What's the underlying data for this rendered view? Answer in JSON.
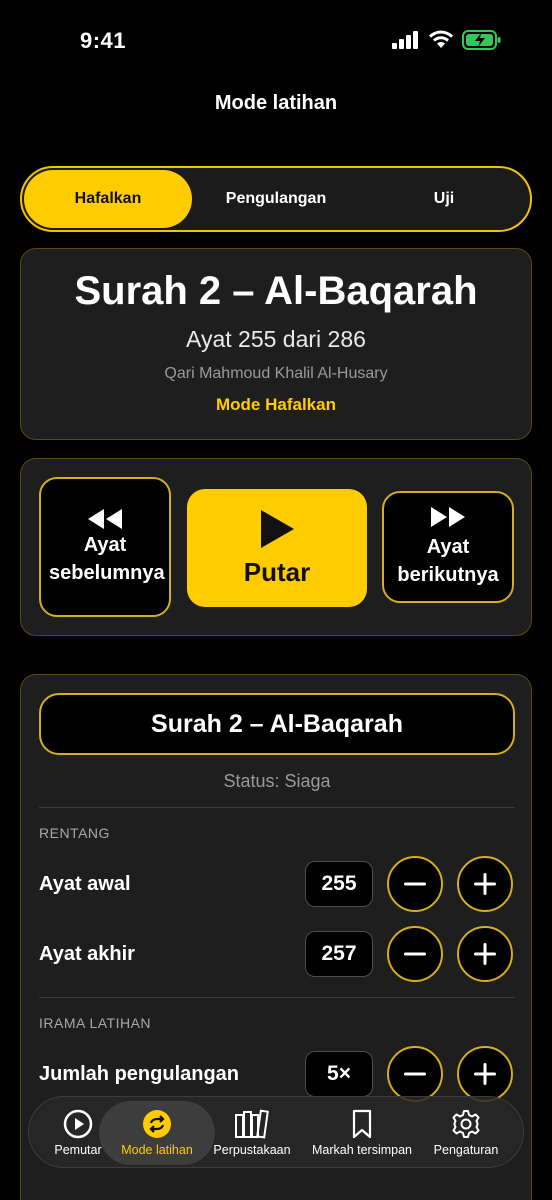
{
  "status_bar": {
    "time": "9:41"
  },
  "nav": {
    "title": "Mode latihan"
  },
  "segments": [
    {
      "label": "Hafalkan",
      "active": true
    },
    {
      "label": "Pengulangan",
      "active": false
    },
    {
      "label": "Uji",
      "active": false
    }
  ],
  "surah_card": {
    "title": "Surah 2 – Al-Baqarah",
    "ayat": "Ayat 255 dari 286",
    "qari": "Qari Mahmoud Khalil Al-Husary",
    "mode": "Mode Hafalkan"
  },
  "controls": {
    "prev_label": "Ayat sebelumnya",
    "play_label": "Putar",
    "next_label": "Ayat berikutnya"
  },
  "settings": {
    "surah_select": "Surah 2 – Al-Baqarah",
    "status": "Status: Siaga",
    "range_header": "RENTANG",
    "start_label": "Ayat awal",
    "start_value": "255",
    "end_label": "Ayat akhir",
    "end_value": "257",
    "rhythm_header": "IRAMA LATIHAN",
    "repeat_label": "Jumlah pengulangan",
    "repeat_value": "5×"
  },
  "tabbar": {
    "items": [
      {
        "label": "Pemutar",
        "icon": "play-circle-icon"
      },
      {
        "label": "Mode latihan",
        "icon": "repeat-icon",
        "active": true
      },
      {
        "label": "Perpustakaan",
        "icon": "books-icon"
      },
      {
        "label": "Markah tersimpan",
        "icon": "bookmark-icon"
      },
      {
        "label": "Pengaturan",
        "icon": "gear-icon"
      }
    ]
  },
  "colors": {
    "accent": "#FFCC00",
    "background": "#000000",
    "card": "#1E1E1E",
    "battery": "#34C759"
  }
}
